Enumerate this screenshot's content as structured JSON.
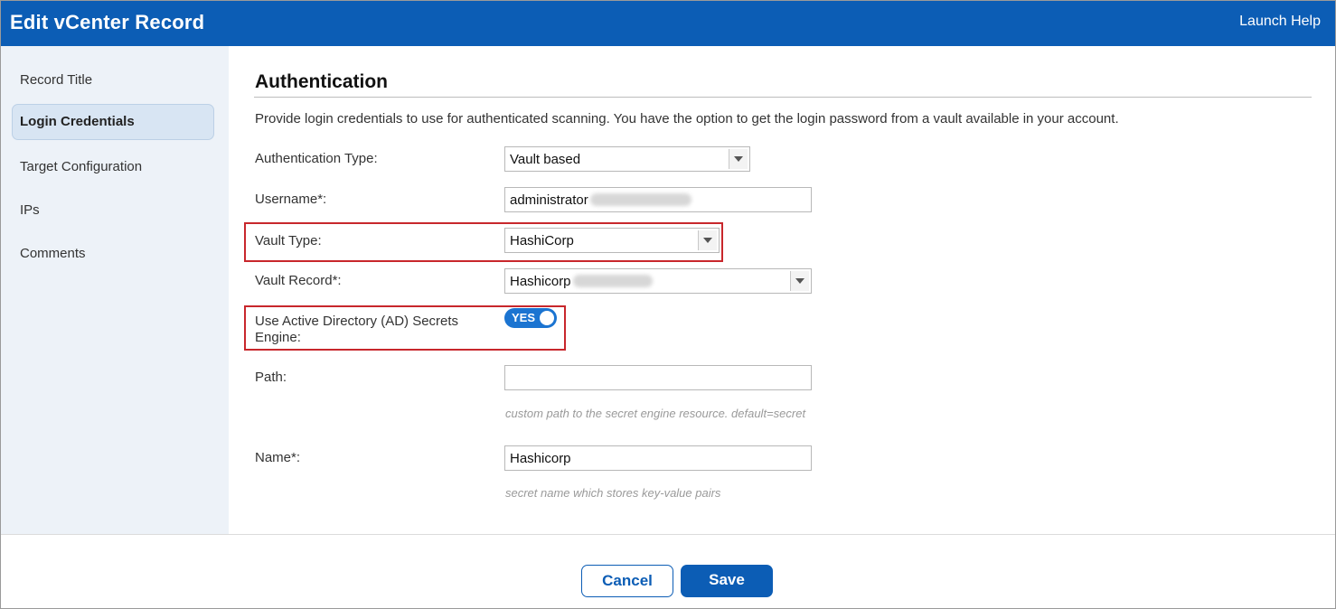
{
  "window": {
    "title": "Edit vCenter Record",
    "help_link": "Launch Help"
  },
  "sidebar": {
    "items": [
      {
        "label": "Record Title",
        "active": false
      },
      {
        "label": "Login Credentials",
        "active": true
      },
      {
        "label": "Target Configuration",
        "active": false
      },
      {
        "label": "IPs",
        "active": false
      },
      {
        "label": "Comments",
        "active": false
      }
    ]
  },
  "auth": {
    "title": "Authentication",
    "description": "Provide login credentials to use for authenticated scanning. You have the option to get the login password from a vault available in your account.",
    "auth_type": {
      "label": "Authentication Type:",
      "value": "Vault based"
    },
    "username": {
      "label": "Username*:",
      "value": "administrator"
    },
    "vault_type": {
      "label": "Vault Type:",
      "value": "HashiCorp"
    },
    "vault_record": {
      "label": "Vault Record*:",
      "value": "Hashicorp"
    },
    "ad_engine": {
      "label": "Use Active Directory (AD) Secrets Engine:",
      "toggle_label": "YES",
      "enabled": true
    },
    "path": {
      "label": "Path:",
      "value": "",
      "hint": "custom path to the secret engine resource. default=secret"
    },
    "name": {
      "label": "Name*:",
      "value": "Hashicorp",
      "hint": "secret name which stores key-value pairs"
    }
  },
  "footer": {
    "cancel_label": "Cancel",
    "save_label": "Save"
  },
  "colors": {
    "brand": "#0c5db5",
    "highlight": "#c8272c",
    "toggle_on": "#1b74d1"
  }
}
